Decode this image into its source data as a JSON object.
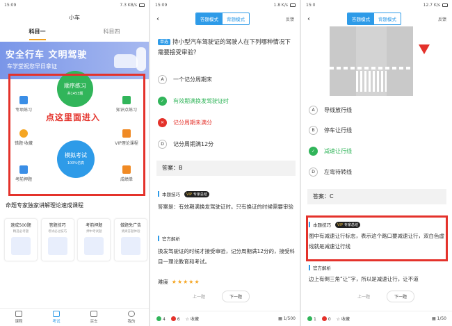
{
  "p1": {
    "status": {
      "time": "15:09",
      "right": "7.3 KB/s"
    },
    "title": "小车",
    "tabs": [
      "科目一",
      "科目四"
    ],
    "banner": {
      "line1": "安全行车 文明驾驶",
      "line2": "车学堂祝您早日拿证"
    },
    "circles": [
      {
        "main": "顺序练习",
        "sub": "共1453题"
      },
      {
        "main": "模拟考试",
        "sub": "100%仿真"
      }
    ],
    "features": [
      "专项练习",
      "知识点练习",
      "错题·收藏",
      "VIP理论课程",
      "考前押题",
      "成绩单"
    ],
    "hint": "点这里面进入",
    "course_title": "命题专家独家讲解理论速成课程",
    "cards": [
      {
        "title": "速成500题",
        "sub": "精选必考题"
      },
      {
        "title": "答题技巧",
        "sub": "考试必过技巧"
      },
      {
        "title": "考前押题",
        "sub": "押中考试题"
      },
      {
        "title": "做题免广告",
        "sub": "清爽答题体验"
      }
    ],
    "tabbar": [
      "课程",
      "考试",
      "买车",
      "我的"
    ]
  },
  "p2": {
    "status": {
      "time": "15:09",
      "right": "1.8 K/s"
    },
    "modes": [
      "答题模式",
      "背题模式"
    ],
    "feedback": "反馈",
    "question": {
      "tag": "单选",
      "text": "持小型汽车驾驶证的驾驶人在下列哪种情况下需要接受审验？"
    },
    "options": [
      {
        "letter": "A",
        "text": "一个记分周期末",
        "state": "none"
      },
      {
        "letter": "✓",
        "text": "有效期满换发驾驶证时",
        "state": "ok"
      },
      {
        "letter": "✕",
        "text": "记分周期未满分",
        "state": "bad"
      },
      {
        "letter": "D",
        "text": "记分周期满12分",
        "state": "none"
      }
    ],
    "answer": "答案：B",
    "tips_label": "本题技巧",
    "vip": "VIP",
    "vip_tag": "专家总结",
    "tips_text": "答案是：有效期满换发驾驶证时。只有换证的时候需要审验",
    "official_label": "官方解析",
    "official_text": "换发驾驶证的时候才接受审验，记分周期满12分的，接受科目一理论教育和考试。",
    "difficulty_label": "难度",
    "stars": "★★★★★",
    "prev": "上一题",
    "next": "下一题",
    "bottom": {
      "right_count": "4",
      "wrong_count": "6",
      "collect": "收藏",
      "progress": "1/500"
    }
  },
  "p3": {
    "status": {
      "time": "15:0",
      "right": "12.7 K/s"
    },
    "modes": [
      "答题模式",
      "背题模式"
    ],
    "feedback": "反馈",
    "options": [
      {
        "letter": "A",
        "text": "导线放行线",
        "state": "none"
      },
      {
        "letter": "B",
        "text": "停车让行线",
        "state": "none"
      },
      {
        "letter": "✓",
        "text": "减速让行线",
        "state": "ok"
      },
      {
        "letter": "D",
        "text": "左弯待转线",
        "state": "none"
      }
    ],
    "answer": "答案：C",
    "tips_label": "本题技巧",
    "vip": "VIP",
    "vip_tag": "专家总结",
    "tips_text": "图中有减速让行标志，表示这个路口要减速让行，双白色虚线就是减速让行线",
    "official_label": "官方解析",
    "official_text": "边上有倒三角“让”字，所以是减速让行，让不道",
    "prev": "上一题",
    "next": "下一题",
    "bottom": {
      "right_count": "1",
      "wrong_count": "0",
      "collect": "收藏",
      "progress": "1/50"
    }
  }
}
